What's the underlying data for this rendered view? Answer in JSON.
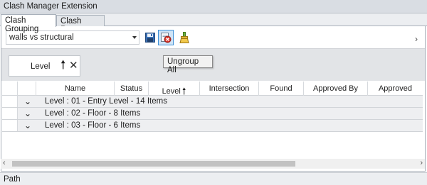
{
  "window": {
    "title": "Clash Manager Extension"
  },
  "tabs": [
    {
      "label": "Clash Grouping",
      "active": true
    },
    {
      "label": "Clash Reports",
      "active": false
    }
  ],
  "toolbar": {
    "test_selector": {
      "value": "walls vs structural"
    },
    "buttons": [
      {
        "icon": "save-icon"
      },
      {
        "icon": "ungroup-icon",
        "tooltip": "Ungroup All"
      },
      {
        "icon": "clean-brush-icon"
      }
    ],
    "overflow_icon": "chevron-right-icon"
  },
  "group_panel": {
    "chip": {
      "label": "Level",
      "sort": "ascending",
      "sort_glyph": "🠕",
      "remove_glyph": "✕"
    }
  },
  "grid": {
    "columns": [
      "Name",
      "Status",
      "Level",
      "Intersection",
      "Found",
      "Approved By",
      "Approved"
    ],
    "sort_glyph": "🠕",
    "groups": [
      {
        "label": "Level : 01 - Entry Level - 14 Items"
      },
      {
        "label": "Level : 02 - Floor - 8 Items"
      },
      {
        "label": "Level : 03 - Floor - 6 Items"
      }
    ]
  },
  "status_bar": {
    "text": "Path"
  },
  "colors": {
    "hover_fill": "#cfe4f7",
    "hover_border": "#3d8fd6",
    "group_row_bg": "#eeeff1"
  }
}
